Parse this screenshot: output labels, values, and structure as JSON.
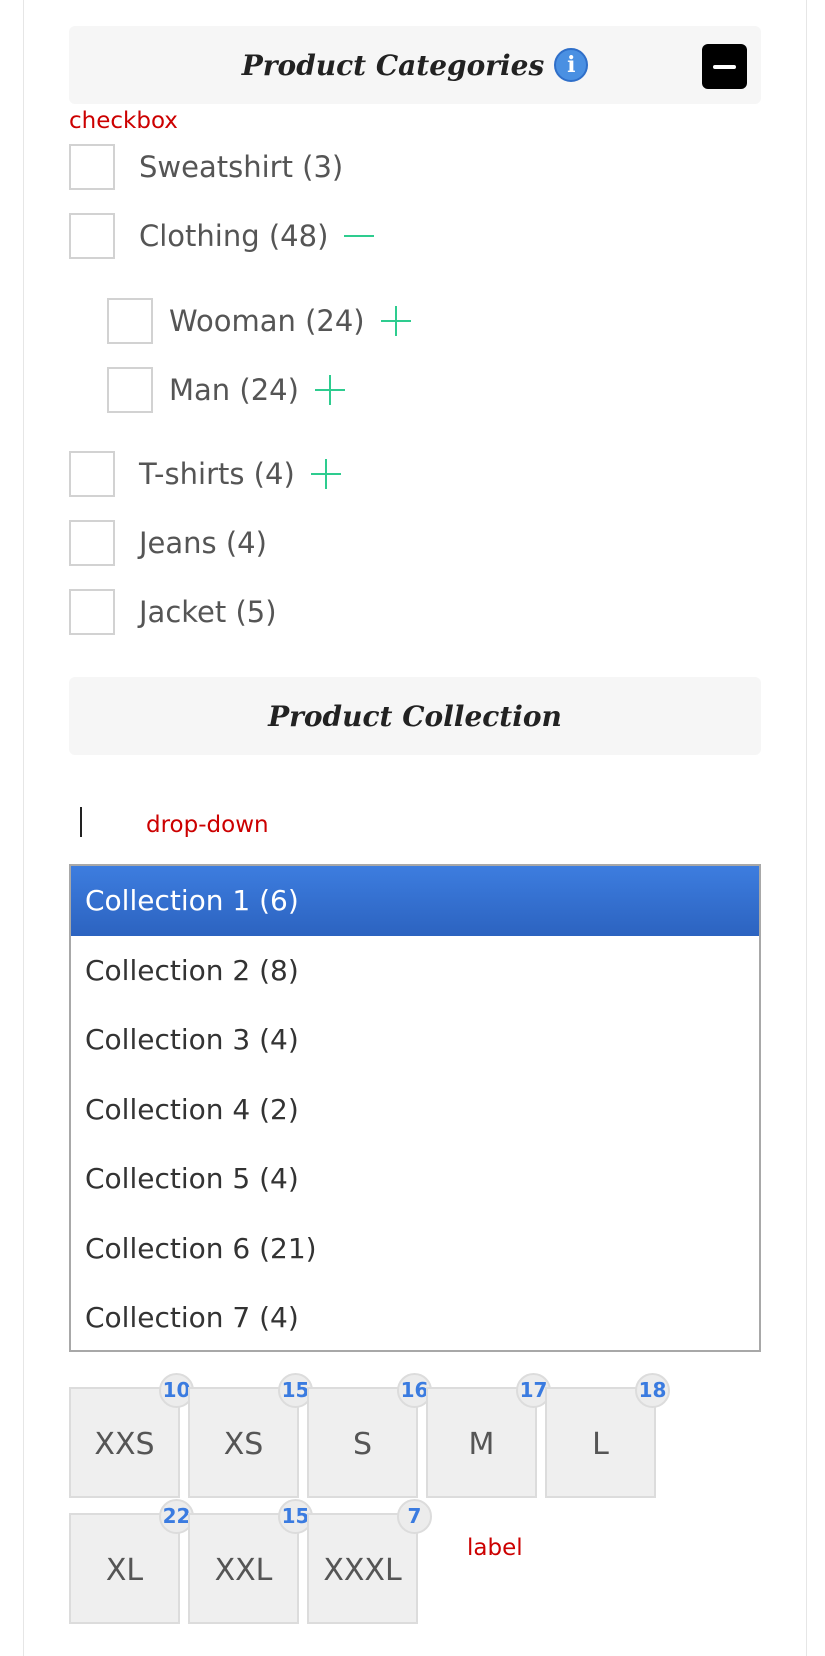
{
  "categories_panel": {
    "title": "Product Categories",
    "info_icon": "i",
    "annotation": "checkbox",
    "items": [
      {
        "label": "Sweatshirt (3)",
        "toggle": "none"
      },
      {
        "label": "Clothing (48)",
        "toggle": "minus"
      },
      {
        "label": "Wooman (24)",
        "toggle": "plus"
      },
      {
        "label": "Man (24)",
        "toggle": "plus"
      },
      {
        "label": "T-shirts (4)",
        "toggle": "plus"
      },
      {
        "label": "Jeans (4)",
        "toggle": "none"
      },
      {
        "label": "Jacket (5)",
        "toggle": "none"
      }
    ]
  },
  "collection_panel": {
    "title": "Product Collection",
    "annotation": "drop-down",
    "selected_index": 0,
    "options": [
      "Collection 1 (6)",
      "Collection 2 (8)",
      "Collection 3 (4)",
      "Collection 4 (2)",
      "Collection 5 (4)",
      "Collection 6 (21)",
      "Collection 7 (4)"
    ]
  },
  "size_panel": {
    "annotation": "label",
    "sizes": [
      {
        "label": "XXS",
        "count": "10"
      },
      {
        "label": "XS",
        "count": "15"
      },
      {
        "label": "S",
        "count": "16"
      },
      {
        "label": "M",
        "count": "17"
      },
      {
        "label": "L",
        "count": "18"
      },
      {
        "label": "XL",
        "count": "22"
      },
      {
        "label": "XXL",
        "count": "15"
      },
      {
        "label": "XXXL",
        "count": "7"
      }
    ]
  },
  "colors": {
    "accent_blue": "#2c63c0",
    "toggle_green": "#2ecc8f",
    "annotation_red": "#cc0000",
    "count_blue": "#3a7be0"
  },
  "icons": {
    "info": "info-icon",
    "collapse": "minus-square-icon",
    "expand": "plus-icon",
    "collapse_branch": "minus-icon"
  }
}
